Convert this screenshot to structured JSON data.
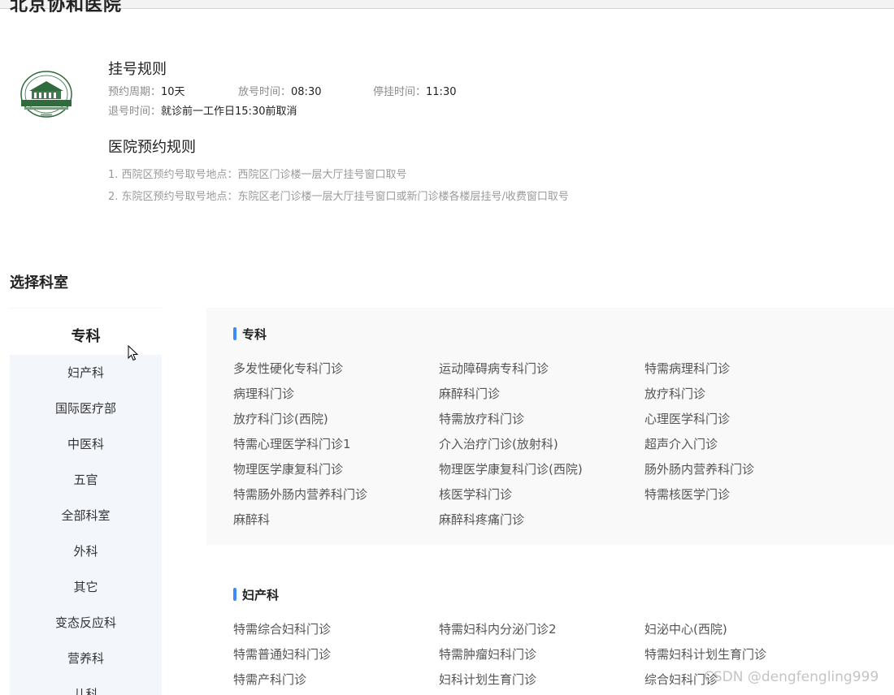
{
  "hospital": {
    "name": "北京协和医院"
  },
  "register_rules": {
    "heading": "挂号规则",
    "row1": [
      {
        "label": "预约周期：",
        "value": "10天"
      },
      {
        "label": "放号时间：",
        "value": "08:30"
      },
      {
        "label": "停挂时间：",
        "value": "11:30"
      }
    ],
    "row2": [
      {
        "label": "退号时间：",
        "value": "就诊前一工作日15:30前取消"
      }
    ]
  },
  "booking_rules": {
    "heading": "医院预约规则",
    "lines": [
      "1. 西院区预约号取号地点：西院区门诊楼一层大厅挂号窗口取号",
      "2. 东院区预约号取号地点：东院区老门诊楼一层大厅挂号窗口或新门诊楼各楼层挂号/收费窗口取号"
    ]
  },
  "choose_dept": {
    "title": "选择科室"
  },
  "sidebar": {
    "items": [
      "专科",
      "妇产科",
      "国际医疗部",
      "中医科",
      "五官",
      "全部科室",
      "外科",
      "其它",
      "变态反应科",
      "营养科",
      "儿科"
    ],
    "active_index": 0
  },
  "panels": [
    {
      "title": "专科",
      "items": [
        "多发性硬化专科门诊",
        "运动障碍病专科门诊",
        "特需病理科门诊",
        "病理科门诊",
        "麻醉科门诊",
        "放疗科门诊",
        "放疗科门诊(西院)",
        "特需放疗科门诊",
        "心理医学科门诊",
        "特需心理医学科门诊1",
        "介入治疗门诊(放射科)",
        "超声介入门诊",
        "物理医学康复科门诊",
        "物理医学康复科门诊(西院)",
        "肠外肠内营养科门诊",
        "特需肠外肠内营养科门诊",
        "核医学科门诊",
        "特需核医学门诊",
        "麻醉科",
        "麻醉科疼痛门诊"
      ]
    },
    {
      "title": "妇产科",
      "items": [
        "特需综合妇科门诊",
        "特需妇科内分泌门诊2",
        "妇泌中心(西院)",
        "特需普通妇科门诊",
        "特需肿瘤妇科门诊",
        "特需妇科计划生育门诊",
        "特需产科门诊",
        "妇科计划生育门诊",
        "综合妇科门诊"
      ]
    }
  ],
  "watermark": "CSDN @dengfengling999",
  "colors": {
    "accent_bar": "#3b8cf7",
    "sidebar_bg": "#f3f7fc",
    "panel_bg": "#f9f9f9"
  }
}
